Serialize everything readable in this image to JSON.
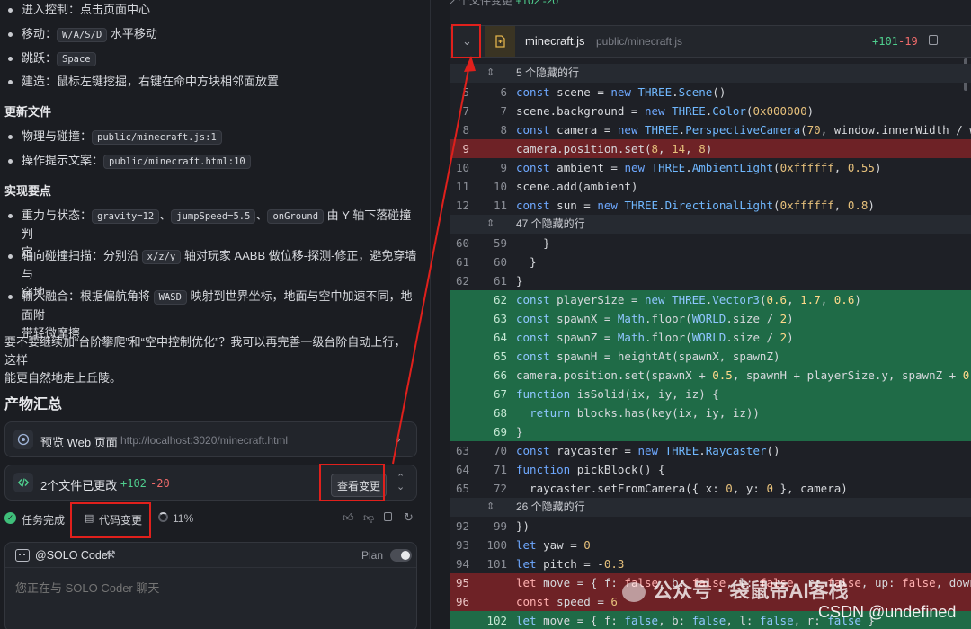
{
  "chat": {
    "bullets_top": [
      {
        "text": "进入控制：点击页面中心"
      },
      {
        "pre": "移动：",
        "code": "W/A/S/D",
        "post": " 水平移动"
      },
      {
        "pre": "跳跃：",
        "code": "Space",
        "post": ""
      },
      {
        "text": "建造：鼠标左键挖掘，右键在命中方块相邻面放置"
      }
    ],
    "heading_update": "更新文件",
    "bullets_update": [
      {
        "pre": "物理与碰撞：",
        "code": "public/minecraft.js:1"
      },
      {
        "pre": "操作提示文案：",
        "code": "public/minecraft.html:10"
      }
    ],
    "heading_impl": "实现要点",
    "impl_1": {
      "pre": "重力与状态：",
      "code1": "gravity=12",
      "sep1": "、",
      "code2": "jumpSpeed=5.5",
      "sep2": "、",
      "code3": "onGround",
      "post": " 由 Y 轴下落碰撞判",
      "line2": "定"
    },
    "impl_2": {
      "pre": "轴向碰撞扫描：分别沿 ",
      "code": "x/z/y",
      "post": " 轴对玩家 AABB 做位移-探测-修正，避免穿墙与",
      "line2": "穿地"
    },
    "impl_3": {
      "pre": "输入融合：根据偏航角将 ",
      "code": "WASD",
      "post": " 映射到世界坐标，地面与空中加速不同，地面附",
      "line2": "带轻微摩擦"
    },
    "question_1": "要不要继续加“台阶攀爬”和“空中控制优化”？我可以再完善一级台阶自动上行，这样",
    "question_2": "能更自然地走上丘陵。"
  },
  "artifacts": {
    "title": "产物汇总",
    "preview": {
      "label": "预览 Web 页面",
      "url": "http://localhost:3020/minecraft.html"
    },
    "changes": {
      "label": "2个文件已更改",
      "added": "+102",
      "removed": "-20",
      "button": "查看变更"
    }
  },
  "status": {
    "done": "任务完成",
    "code_changes": "代码变更",
    "progress": "11%"
  },
  "coder": {
    "name": "@SOLO Coder",
    "plan": "Plan",
    "placeholder": "您正在与 SOLO Coder 聊天"
  },
  "diff": {
    "summary_prefix": "2 个文件变更",
    "summary_added": "+102 -20",
    "file_name": "minecraft.js",
    "file_path": "public/minecraft.js",
    "added": "+101",
    "removed": "-19"
  },
  "watermark": {
    "wechat": "公众号 · 袋鼠帝AI客栈",
    "csdn": "CSDN @undefined"
  },
  "colors": {
    "added": "#1f6b47",
    "removed": "#6e2226",
    "annotation": "#e0201c"
  }
}
